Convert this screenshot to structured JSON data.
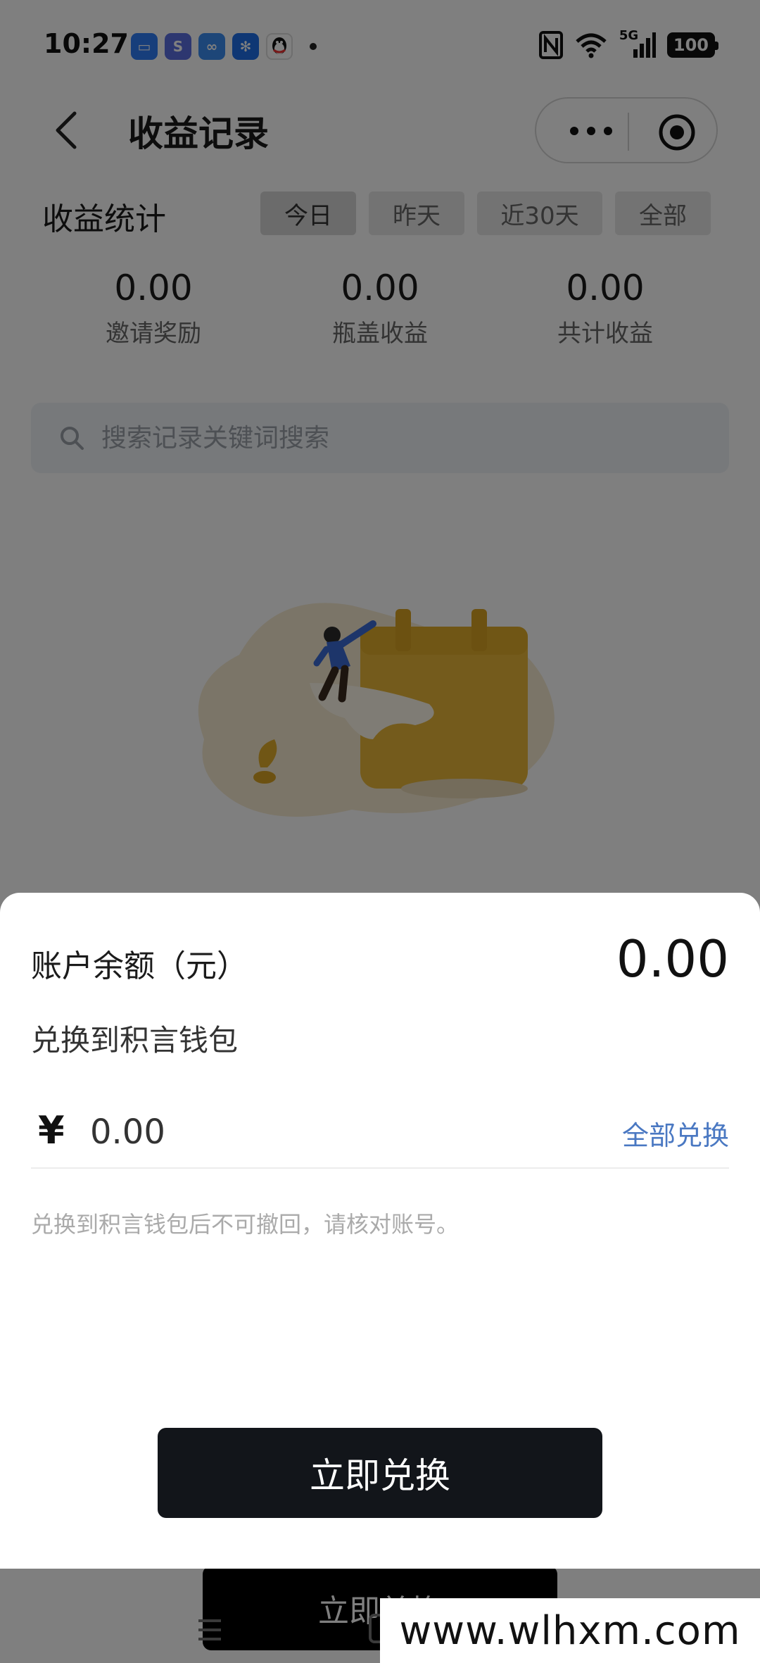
{
  "status_bar": {
    "time": "10:27",
    "network": "5G",
    "battery": "100",
    "app_icons": [
      {
        "name": "message-app-icon",
        "color": "#2f7cf6",
        "glyph": "▭"
      },
      {
        "name": "notes-app-icon",
        "color": "#5b6ee1",
        "glyph": "S"
      },
      {
        "name": "cloud-app-icon",
        "color": "#3b8cf0",
        "glyph": "∞"
      },
      {
        "name": "fan-app-icon",
        "color": "#1e6fe8",
        "glyph": "✻"
      },
      {
        "name": "qq-app-icon",
        "color": "#ffffff",
        "glyph": "🐧"
      }
    ]
  },
  "header": {
    "title": "收益记录",
    "back_icon": "chevron-left-icon",
    "more_icon": "more-dots-icon",
    "target_icon": "target-icon"
  },
  "stats": {
    "title": "收益统计",
    "tabs": [
      {
        "label": "今日",
        "active": true
      },
      {
        "label": "昨天",
        "active": false
      },
      {
        "label": "近30天",
        "active": false
      },
      {
        "label": "全部",
        "active": false
      }
    ],
    "items": [
      {
        "value": "0.00",
        "label": "邀请奖励"
      },
      {
        "value": "0.00",
        "label": "瓶盖收益"
      },
      {
        "value": "0.00",
        "label": "共计收益"
      }
    ]
  },
  "search": {
    "placeholder": "搜索记录关键词搜索"
  },
  "background_button": {
    "label": "立即兑换"
  },
  "sheet": {
    "balance_label": "账户余额（元）",
    "balance_value": "0.00",
    "subtitle": "兑换到积言钱包",
    "currency_symbol": "¥",
    "amount_placeholder": "0.00",
    "all_exchange_label": "全部兑换",
    "note": "兑换到积言钱包后不可撤回，请核对账号。",
    "submit_label": "立即兑换"
  },
  "watermark": "www.wlhxm.com",
  "colors": {
    "accent_link": "#4a78c2",
    "button_dark": "#12151a",
    "illustration_yellow": "#e8b738"
  }
}
